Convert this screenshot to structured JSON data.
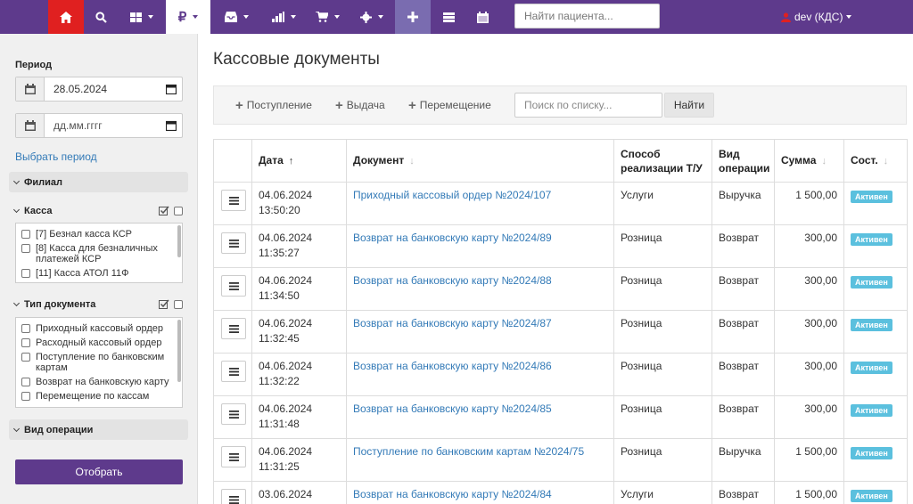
{
  "topnav": {
    "search_placeholder": "Найти пациента...",
    "user_label": "dev  (КДС)",
    "colors": {
      "bar": "#5e3a8c",
      "home": "#e02020",
      "active": "#ffffff",
      "plus": "#7a6cb0"
    },
    "icons": [
      "home-icon",
      "search-icon",
      "grid-icon",
      "ruble-icon",
      "inbox-icon",
      "bar-chart-icon",
      "cart-icon",
      "gear-icon",
      "plus-icon",
      "list-icon",
      "calendar-icon"
    ]
  },
  "sidebar": {
    "period_label": "Период",
    "date_from": "28.05.2024",
    "date_to": "дд.мм.гггг",
    "choose_period": "Выбрать период",
    "branch_label": "Филиал",
    "cash_label": "Касса",
    "cash_items": [
      "[7] Безнал касса КСР",
      "[8] Касса для безналичных платежей КСР",
      "[11] Касса АТОЛ 11Ф"
    ],
    "doc_type_label": "Тип документа",
    "doc_type_items": [
      "Приходный кассовый ордер",
      "Расходный кассовый ордер",
      "Поступление по банковским картам",
      "Возврат на банковскую карту",
      "Перемещение по кассам"
    ],
    "operation_label": "Вид операции",
    "submit": "Отобрать"
  },
  "main": {
    "title": "Кассовые документы",
    "toolbar": {
      "income": "Поступление",
      "issue": "Выдача",
      "move": "Перемещение",
      "search_placeholder": "Поиск по списку...",
      "find": "Найти"
    },
    "columns": {
      "date": "Дата",
      "document": "Документ",
      "method": "Способ реализации Т/У",
      "operation": "Вид операции",
      "sum": "Сумма",
      "state": "Сост."
    },
    "rows": [
      {
        "date": "04.06.2024",
        "time": "13:50:20",
        "doc": "Приходный кассовый ордер №2024/107",
        "method": "Услуги",
        "op": "Выручка",
        "sum": "1 500,00",
        "state": "Активен"
      },
      {
        "date": "04.06.2024",
        "time": "11:35:27",
        "doc": "Возврат на банковскую карту №2024/89",
        "method": "Розница",
        "op": "Возврат",
        "sum": "300,00",
        "state": "Активен"
      },
      {
        "date": "04.06.2024",
        "time": "11:34:50",
        "doc": "Возврат на банковскую карту №2024/88",
        "method": "Розница",
        "op": "Возврат",
        "sum": "300,00",
        "state": "Активен"
      },
      {
        "date": "04.06.2024",
        "time": "11:32:45",
        "doc": "Возврат на банковскую карту №2024/87",
        "method": "Розница",
        "op": "Возврат",
        "sum": "300,00",
        "state": "Активен"
      },
      {
        "date": "04.06.2024",
        "time": "11:32:22",
        "doc": "Возврат на банковскую карту №2024/86",
        "method": "Розница",
        "op": "Возврат",
        "sum": "300,00",
        "state": "Активен"
      },
      {
        "date": "04.06.2024",
        "time": "11:31:48",
        "doc": "Возврат на банковскую карту №2024/85",
        "method": "Розница",
        "op": "Возврат",
        "sum": "300,00",
        "state": "Активен"
      },
      {
        "date": "04.06.2024",
        "time": "11:31:25",
        "doc": "Поступление по банковским картам №2024/75",
        "method": "Розница",
        "op": "Выручка",
        "sum": "1 500,00",
        "state": "Активен"
      },
      {
        "date": "03.06.2024",
        "time": "",
        "doc": "Возврат на банковскую карту №2024/84",
        "method": "Услуги",
        "op": "Возврат",
        "sum": "1 500,00",
        "state": "Активен"
      }
    ]
  }
}
